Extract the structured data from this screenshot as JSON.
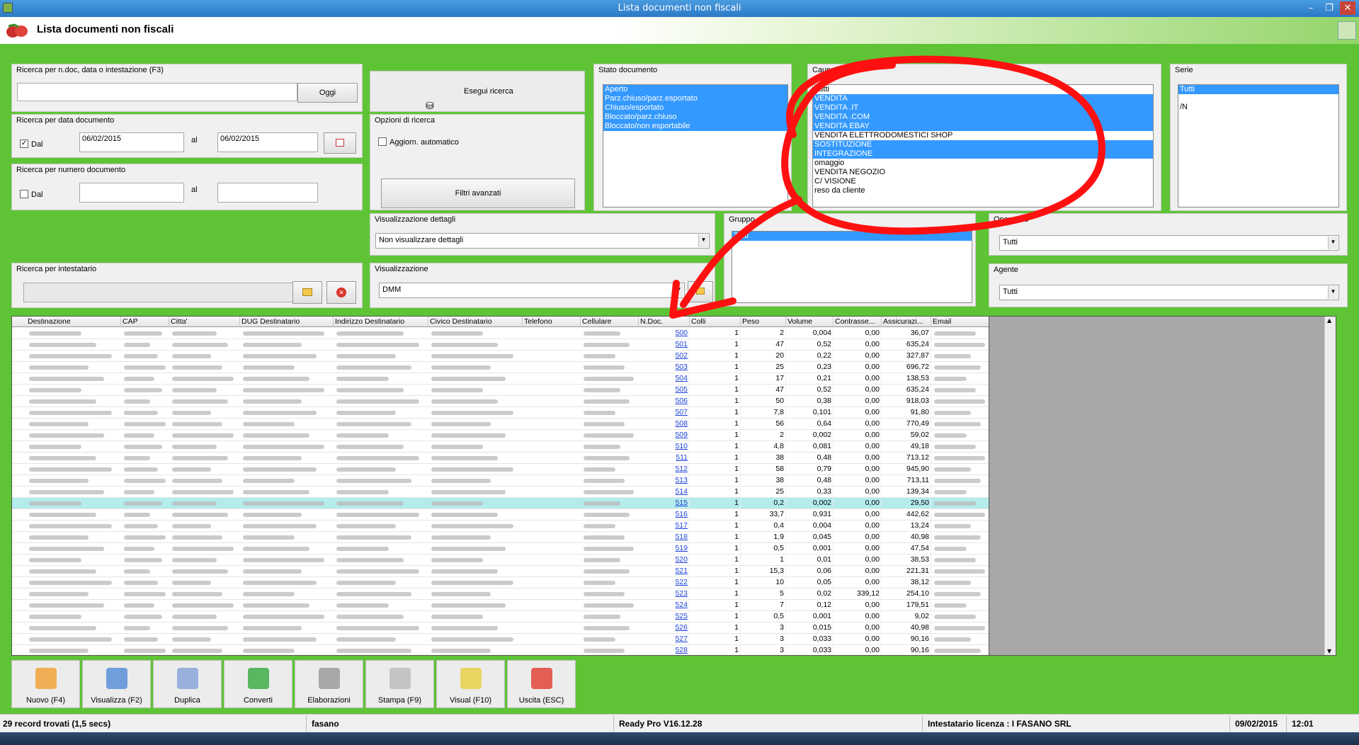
{
  "window": {
    "title": "Lista documenti non fiscali",
    "header_title": "Lista documenti non fiscali"
  },
  "search_text": {
    "label": "Ricerca per n.doc, data o intestazione (F3)",
    "value": "",
    "today_button": "Oggi"
  },
  "execute_button": "Esegui ricerca",
  "date_search": {
    "label": "Ricerca per data documento",
    "from_label": "Dal",
    "from_checked": true,
    "from_value": "06/02/2015",
    "to_label": "al",
    "to_value": "06/02/2015"
  },
  "number_search": {
    "label": "Ricerca per numero documento",
    "from_label": "Dal",
    "to_label": "al"
  },
  "options": {
    "label": "Opzioni di ricerca",
    "auto_update": "Aggiorn. automatico",
    "advanced_filters": "Filtri avanzati"
  },
  "stato": {
    "label": "Stato documento",
    "items": [
      {
        "text": "Aperto",
        "selected": true
      },
      {
        "text": "Parz.chiuso/parz.esportato",
        "selected": true
      },
      {
        "text": "Chiuso/esportato",
        "selected": true
      },
      {
        "text": "Bloccato/parz.chiuso",
        "selected": true
      },
      {
        "text": "Bloccato/non esportabile",
        "selected": true
      }
    ]
  },
  "causale": {
    "label": "Causale",
    "items": [
      {
        "text": "Tutti",
        "selected": false
      },
      {
        "text": "VENDITA",
        "selected": true
      },
      {
        "text": "VENDITA .IT",
        "selected": true
      },
      {
        "text": "VENDITA .COM",
        "selected": true
      },
      {
        "text": "VENDITA EBAY",
        "selected": true
      },
      {
        "text": "VENDITA ELETTRODOMESTICI SHOP",
        "selected": false
      },
      {
        "text": "SOSTITUZIONE",
        "selected": true
      },
      {
        "text": "INTEGRAZIONE",
        "selected": true
      },
      {
        "text": "omaggio",
        "selected": false
      },
      {
        "text": "VENDITA NEGOZIO",
        "selected": false
      },
      {
        "text": "C/ VISIONE",
        "selected": false
      },
      {
        "text": "reso da cliente",
        "selected": false
      }
    ]
  },
  "serie": {
    "label": "Serie",
    "items": [
      {
        "text": "Tutti",
        "selected": true
      },
      {
        "text": "/N",
        "selected": false
      }
    ]
  },
  "visual_dettagli": {
    "label": "Visualizzazione dettagli",
    "value": "Non visualizzare dettagli"
  },
  "visualizzazione": {
    "label": "Visualizzazione",
    "value": "DMM"
  },
  "gruppo": {
    "label": "Gruppo",
    "items": [
      {
        "text": "Tutti",
        "selected": true
      }
    ]
  },
  "operatore": {
    "label": "Operatore",
    "value": "Tutti"
  },
  "agente": {
    "label": "Agente",
    "value": "Tutti"
  },
  "intestatario": {
    "label": "Ricerca per intestatario",
    "value": ""
  },
  "colors": {
    "background": "#5fc435",
    "selection": "#3399ff",
    "highlight_row": "#b4ecec",
    "annotation": "#ff0000"
  },
  "grid": {
    "columns": [
      "Destinazione",
      "CAP",
      "Citta'",
      "DUG Destinatario",
      "Indirizzo Destinatario",
      "Civico Destinatario",
      "Telefono",
      "Cellulare",
      "N.Doc.",
      "Colli",
      "Peso",
      "Volume",
      "Contrasse...",
      "Assicurazi...",
      "Email"
    ],
    "highlighted_row": 15,
    "rows": [
      {
        "ndoc": "500",
        "colli": "1",
        "peso": "2",
        "volume": "0,004",
        "contr": "0,00",
        "assic": "36,07"
      },
      {
        "ndoc": "501",
        "colli": "1",
        "peso": "47",
        "volume": "0,52",
        "contr": "0,00",
        "assic": "635,24"
      },
      {
        "ndoc": "502",
        "colli": "1",
        "peso": "20",
        "volume": "0,22",
        "contr": "0,00",
        "assic": "327,87"
      },
      {
        "ndoc": "503",
        "colli": "1",
        "peso": "25",
        "volume": "0,23",
        "contr": "0,00",
        "assic": "696,72"
      },
      {
        "ndoc": "504",
        "colli": "1",
        "peso": "17",
        "volume": "0,21",
        "contr": "0,00",
        "assic": "138,53"
      },
      {
        "ndoc": "505",
        "colli": "1",
        "peso": "47",
        "volume": "0,52",
        "contr": "0,00",
        "assic": "635,24"
      },
      {
        "ndoc": "506",
        "colli": "1",
        "peso": "50",
        "volume": "0,38",
        "contr": "0,00",
        "assic": "918,03"
      },
      {
        "ndoc": "507",
        "colli": "1",
        "peso": "7,8",
        "volume": "0,101",
        "contr": "0,00",
        "assic": "91,80"
      },
      {
        "ndoc": "508",
        "colli": "1",
        "peso": "56",
        "volume": "0,64",
        "contr": "0,00",
        "assic": "770,49"
      },
      {
        "ndoc": "509",
        "colli": "1",
        "peso": "2",
        "volume": "0,002",
        "contr": "0,00",
        "assic": "59,02"
      },
      {
        "ndoc": "510",
        "colli": "1",
        "peso": "4,8",
        "volume": "0,081",
        "contr": "0,00",
        "assic": "49,18"
      },
      {
        "ndoc": "511",
        "colli": "1",
        "peso": "38",
        "volume": "0,48",
        "contr": "0,00",
        "assic": "713,12"
      },
      {
        "ndoc": "512",
        "colli": "1",
        "peso": "58",
        "volume": "0,79",
        "contr": "0,00",
        "assic": "945,90"
      },
      {
        "ndoc": "513",
        "colli": "1",
        "peso": "38",
        "volume": "0,48",
        "contr": "0,00",
        "assic": "713,11"
      },
      {
        "ndoc": "514",
        "colli": "1",
        "peso": "25",
        "volume": "0,33",
        "contr": "0,00",
        "assic": "139,34"
      },
      {
        "ndoc": "515",
        "colli": "1",
        "peso": "0,2",
        "volume": "0,002",
        "contr": "0,00",
        "assic": "29,50"
      },
      {
        "ndoc": "516",
        "colli": "1",
        "peso": "33,7",
        "volume": "0,931",
        "contr": "0,00",
        "assic": "442,62"
      },
      {
        "ndoc": "517",
        "colli": "1",
        "peso": "0,4",
        "volume": "0,004",
        "contr": "0,00",
        "assic": "13,24"
      },
      {
        "ndoc": "518",
        "colli": "1",
        "peso": "1,9",
        "volume": "0,045",
        "contr": "0,00",
        "assic": "40,98"
      },
      {
        "ndoc": "519",
        "colli": "1",
        "peso": "0,5",
        "volume": "0,001",
        "contr": "0,00",
        "assic": "47,54"
      },
      {
        "ndoc": "520",
        "colli": "1",
        "peso": "1",
        "volume": "0,01",
        "contr": "0,00",
        "assic": "38,53"
      },
      {
        "ndoc": "521",
        "colli": "1",
        "peso": "15,3",
        "volume": "0,06",
        "contr": "0,00",
        "assic": "221,31"
      },
      {
        "ndoc": "522",
        "colli": "1",
        "peso": "10",
        "volume": "0,05",
        "contr": "0,00",
        "assic": "38,12"
      },
      {
        "ndoc": "523",
        "colli": "1",
        "peso": "5",
        "volume": "0,02",
        "contr": "339,12",
        "assic": "254,10"
      },
      {
        "ndoc": "524",
        "colli": "1",
        "peso": "7",
        "volume": "0,12",
        "contr": "0,00",
        "assic": "179,51"
      },
      {
        "ndoc": "525",
        "colli": "1",
        "peso": "0,5",
        "volume": "0,001",
        "contr": "0,00",
        "assic": "9,02"
      },
      {
        "ndoc": "526",
        "colli": "1",
        "peso": "3",
        "volume": "0,015",
        "contr": "0,00",
        "assic": "40,98"
      },
      {
        "ndoc": "527",
        "colli": "1",
        "peso": "3",
        "volume": "0,033",
        "contr": "0,00",
        "assic": "90,16"
      },
      {
        "ndoc": "528",
        "colli": "1",
        "peso": "3",
        "volume": "0,033",
        "contr": "0,00",
        "assic": "90,16"
      }
    ]
  },
  "toolbar": [
    {
      "label": "Nuovo (F4)",
      "icon": "new-document-icon"
    },
    {
      "label": "Visualizza (F2)",
      "icon": "view-icon"
    },
    {
      "label": "Duplica",
      "icon": "duplicate-icon"
    },
    {
      "label": "Converti",
      "icon": "convert-icon"
    },
    {
      "label": "Elaborazioni",
      "icon": "processing-icon"
    },
    {
      "label": "Stampa (F9)",
      "icon": "printer-icon"
    },
    {
      "label": "Visual (F10)",
      "icon": "magic-wand-icon"
    },
    {
      "label": "Uscita (ESC)",
      "icon": "exit-icon"
    }
  ],
  "status": {
    "records": "29 record trovati (1,5 secs)",
    "user": "fasano",
    "version": "Ready Pro V16.12.28",
    "license": "Intestatario licenza : I FASANO SRL",
    "date": "09/02/2015",
    "time": "12:01"
  }
}
